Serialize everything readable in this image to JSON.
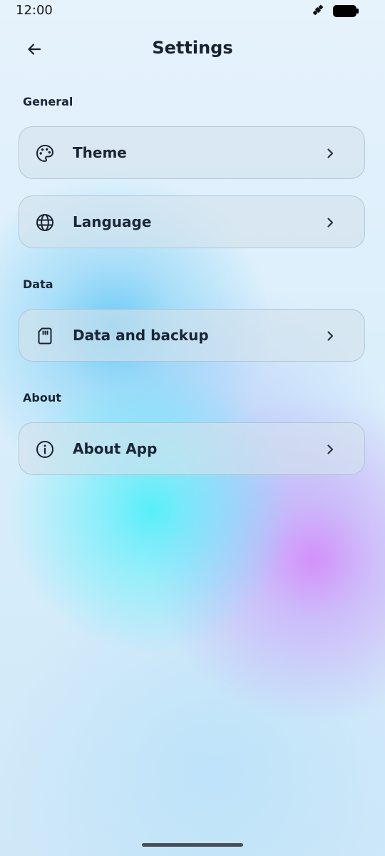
{
  "status_bar": {
    "time": "12:00",
    "icons": [
      "satellite-icon",
      "battery-icon"
    ]
  },
  "app_bar": {
    "title": "Settings",
    "back_icon": "arrow-left-icon"
  },
  "sections": [
    {
      "header": "General",
      "items": [
        {
          "label": "Theme",
          "icon": "palette-icon"
        },
        {
          "label": "Language",
          "icon": "globe-icon"
        }
      ]
    },
    {
      "header": "Data",
      "items": [
        {
          "label": "Data and backup",
          "icon": "sd-card-icon"
        }
      ]
    },
    {
      "header": "About",
      "items": [
        {
          "label": "About App",
          "icon": "info-icon"
        }
      ]
    }
  ],
  "colors": {
    "text": "#1a2536",
    "tile_background": "#d4e2ec",
    "accent_cyan": "#50f0fa",
    "accent_purple": "#d28cfa"
  }
}
